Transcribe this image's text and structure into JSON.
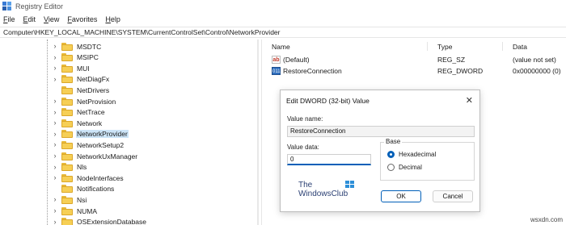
{
  "window": {
    "title": "Registry Editor"
  },
  "menu": [
    {
      "label": "File",
      "ul": "F",
      "rest": "ile"
    },
    {
      "label": "Edit",
      "ul": "E",
      "rest": "dit"
    },
    {
      "label": "View",
      "ul": "V",
      "rest": "iew"
    },
    {
      "label": "Favorites",
      "ul": "F",
      "rest": "avorites"
    },
    {
      "label": "Help",
      "ul": "H",
      "rest": "elp"
    }
  ],
  "address": "Computer\\HKEY_LOCAL_MACHINE\\SYSTEM\\CurrentControlSet\\Control\\NetworkProvider",
  "tree": {
    "items": [
      {
        "label": "MSDTC",
        "expandable": true,
        "selected": false
      },
      {
        "label": "MSIPC",
        "expandable": true,
        "selected": false
      },
      {
        "label": "MUI",
        "expandable": true,
        "selected": false
      },
      {
        "label": "NetDiagFx",
        "expandable": true,
        "selected": false
      },
      {
        "label": "NetDrivers",
        "expandable": false,
        "selected": false
      },
      {
        "label": "NetProvision",
        "expandable": true,
        "selected": false
      },
      {
        "label": "NetTrace",
        "expandable": true,
        "selected": false
      },
      {
        "label": "Network",
        "expandable": true,
        "selected": false
      },
      {
        "label": "NetworkProvider",
        "expandable": true,
        "selected": true
      },
      {
        "label": "NetworkSetup2",
        "expandable": true,
        "selected": false
      },
      {
        "label": "NetworkUxManager",
        "expandable": true,
        "selected": false
      },
      {
        "label": "Nls",
        "expandable": true,
        "selected": false
      },
      {
        "label": "NodeInterfaces",
        "expandable": true,
        "selected": false
      },
      {
        "label": "Notifications",
        "expandable": false,
        "selected": false
      },
      {
        "label": "Nsi",
        "expandable": true,
        "selected": false
      },
      {
        "label": "NUMA",
        "expandable": true,
        "selected": false
      },
      {
        "label": "OSExtensionDatabase",
        "expandable": true,
        "selected": false
      }
    ]
  },
  "list": {
    "headers": {
      "name": "Name",
      "type": "Type",
      "data": "Data"
    },
    "rows": [
      {
        "icon": "string-value-icon",
        "name": "(Default)",
        "type": "REG_SZ",
        "data": "(value not set)"
      },
      {
        "icon": "dword-value-icon",
        "name": "RestoreConnection",
        "type": "REG_DWORD",
        "data": "0x00000000 (0)"
      }
    ]
  },
  "dialog": {
    "title": "Edit DWORD (32-bit) Value",
    "close_glyph": "✕",
    "value_name_label": "Value name:",
    "value_name": "RestoreConnection",
    "value_data_label": "Value data:",
    "value_data": "0",
    "base_label": "Base",
    "base_options": [
      {
        "label": "Hexadecimal",
        "checked": true
      },
      {
        "label": "Decimal",
        "checked": false
      }
    ],
    "ok_label": "OK",
    "cancel_label": "Cancel"
  },
  "watermark": {
    "line1": "The",
    "line2": "WindowsClub"
  },
  "site_mark": "wsxdn.com",
  "colors": {
    "accent": "#005fb8",
    "selection": "#cce4f7",
    "folder": "#f6cf55"
  }
}
